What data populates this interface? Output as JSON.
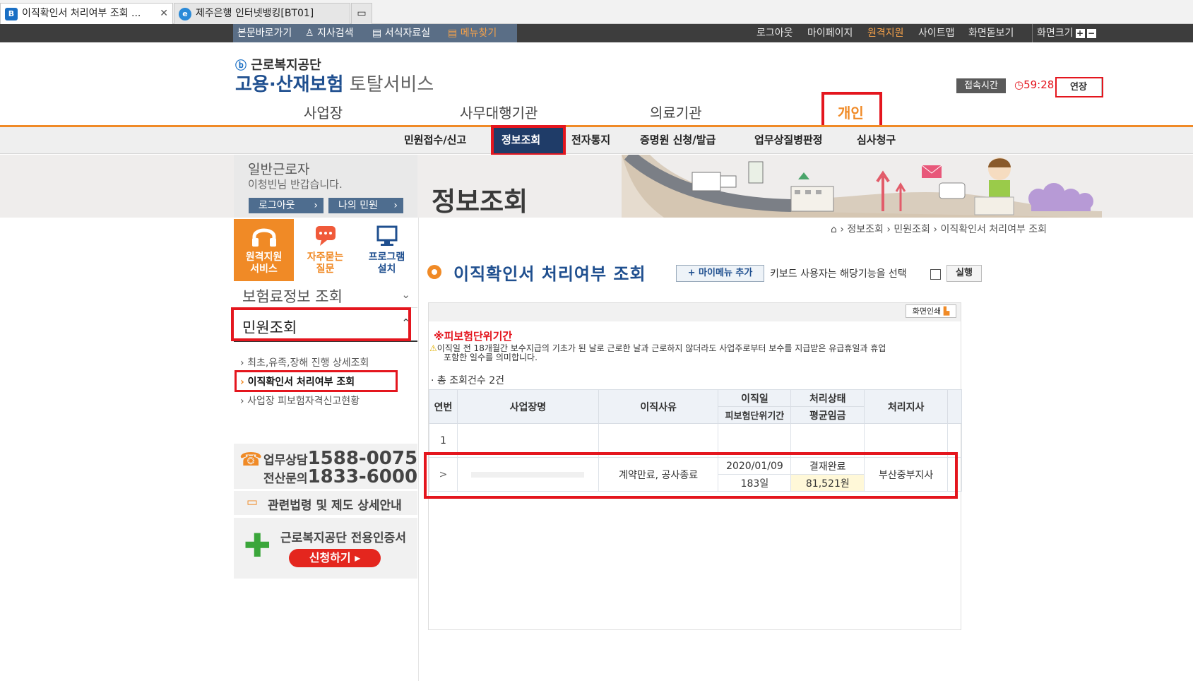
{
  "browser": {
    "tabs": [
      {
        "label": "이직확인서 처리여부 조회 ...",
        "active": true
      },
      {
        "label": "제주은행 인터넷뱅킹[BT01]",
        "active": false
      }
    ]
  },
  "quick_links": [
    "본문바로가기",
    "지사검색",
    "서식자료실",
    "메뉴찾기"
  ],
  "util_links": [
    "로그아웃",
    "마이페이지",
    "원격지원",
    "사이트맵",
    "화면돋보기",
    "화면크기"
  ],
  "logo": {
    "org": "근로복지공단",
    "title": "고용·산재보험",
    "subtitle": "토탈서비스"
  },
  "session": {
    "label": "접속시간",
    "time": "59:28",
    "extend_label": "연장"
  },
  "gnb": [
    "사업장",
    "사무대행기관",
    "의료기관",
    "개인"
  ],
  "subnav": [
    "민원접수/신고",
    "정보조회",
    "전자통지",
    "증명원 신청/발급",
    "업무상질병판정",
    "심사청구"
  ],
  "user": {
    "type": "일반근로자",
    "greeting": "이청빈님 반갑습니다.",
    "logout_label": "로그아웃",
    "my_label": "나의 민원"
  },
  "banner_title": "정보조회",
  "quick_services": [
    "원격지원\n서비스",
    "자주묻는\n질문",
    "프로그램\n설치"
  ],
  "sidebar": {
    "menu1": "보험료정보 조회",
    "menu2": "민원조회",
    "submenu": [
      "최초,유족,장해 진행 상세조회",
      "이직확인서 처리여부 조회",
      "사업장 피보험자격신고현황"
    ]
  },
  "contact": {
    "line1_label": "업무상담",
    "line1_num": "1588-0075",
    "line2_label": "전산문의",
    "line2_num": "1833-6000"
  },
  "law_link": "관련법령 및 제도 상세안내",
  "cert": {
    "title": "근로복지공단 전용인증서",
    "button": "신청하기"
  },
  "breadcrumb": [
    "정보조회",
    "민원조회",
    "이직확인서 처리여부 조회"
  ],
  "page": {
    "title": "이직확인서 처리여부 조회",
    "add_mymenu": "+ 마이메뉴 추가",
    "keyboard_text": "키보드 사용자는 해당기능을 선택",
    "run_label": "실행",
    "print_label": "화면인쇄",
    "notice_title": "※피보험단위기간",
    "notice_text_1": "이직일 전 18개월간 보수지급의 기초가 된 날로 근로한 날과 근로하지 않더라도 사업주로부터 보수를 지급받은 유급휴일과 휴업",
    "notice_text_2": "포함한 일수를 의미합니다.",
    "count_text": "총 조회건수 2건"
  },
  "table": {
    "headers": {
      "no": "연번",
      "name": "사업장명",
      "reason": "이직사유",
      "date_top": "이직일",
      "date_bottom": "피보험단위기간",
      "status_top": "처리상태",
      "status_bottom": "평균임금",
      "branch": "처리지사"
    },
    "rows": [
      {
        "no": "1",
        "name": "",
        "reason": "",
        "date": "",
        "period": "",
        "status": "",
        "wage": "",
        "branch": ""
      },
      {
        "no": ">",
        "name": "",
        "reason": "계약만료, 공사종료",
        "date": "2020/01/09",
        "period": "183일",
        "status": "결재완료",
        "wage": "81,521원",
        "branch": "부산중부지사"
      }
    ]
  },
  "colors": {
    "accent": "#f08a26",
    "highlight": "#e4161e",
    "nav_active": "#1f3c68"
  }
}
